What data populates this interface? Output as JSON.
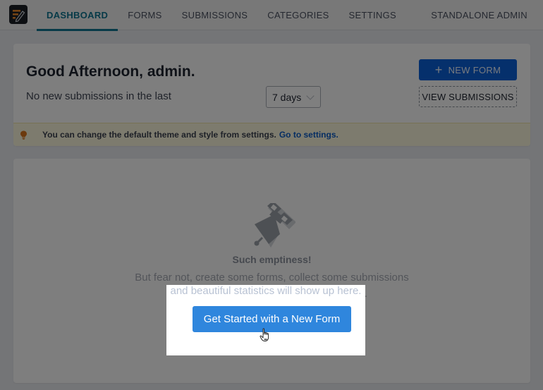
{
  "nav": {
    "logo": "app-logo",
    "items": [
      {
        "label": "DASHBOARD",
        "active": true
      },
      {
        "label": "FORMS",
        "active": false
      },
      {
        "label": "SUBMISSIONS",
        "active": false
      },
      {
        "label": "CATEGORIES",
        "active": false
      },
      {
        "label": "SETTINGS",
        "active": false
      }
    ],
    "right_label": "STANDALONE ADMIN"
  },
  "greeting_card": {
    "title": "Good Afternoon, admin.",
    "subtitle": "No new submissions in the last",
    "period_select": {
      "value": "7 days",
      "icon": "chevron-down-icon"
    },
    "new_form_button": {
      "icon": "plus-icon",
      "label": "NEW FORM"
    },
    "view_submissions_button": {
      "label": "VIEW SUBMISSIONS"
    },
    "notice": {
      "icon": "lightbulb-icon",
      "text": "You can change the default theme and style from settings.",
      "link": "Go to settings."
    }
  },
  "empty_state": {
    "icon": "satellite-icon",
    "title": "Such emptiness!",
    "line1": "But fear not, create some forms, collect some submissions",
    "line2": "and beautiful statistics will show up here.",
    "cta_label": "Get Started with a New Form"
  },
  "overlay": {
    "dim_opacity": 0.5,
    "spotlight_target": "get-started-button",
    "cursor": "hand-pointer-icon"
  },
  "colors": {
    "nav_active": "#0e7490",
    "primary_button": "#0b61d8",
    "cta_button": "#2f86dd",
    "notice_bg": "#fbf6dd",
    "link": "#0b5bc4"
  }
}
